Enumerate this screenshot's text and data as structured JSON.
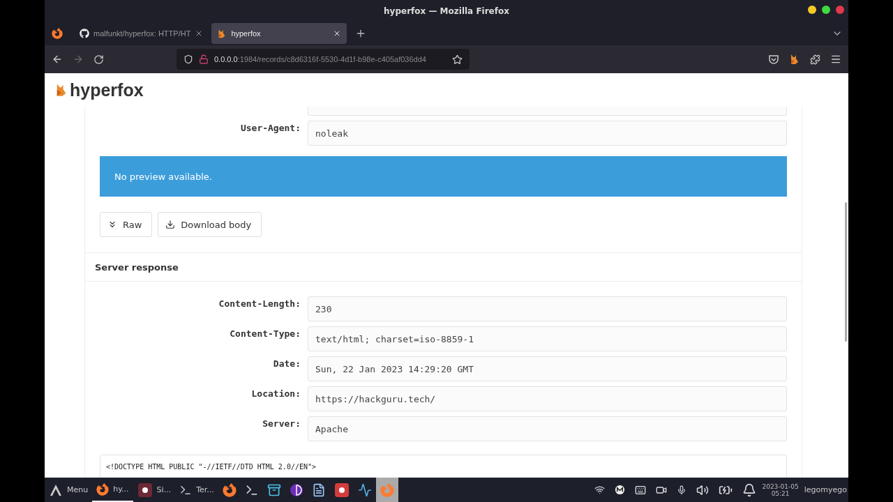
{
  "window": {
    "title": "hyperfox — Mozilla Firefox"
  },
  "tabs": [
    {
      "kind": "github",
      "label": "malfunkt/hyperfox: HTTP/HT",
      "selected": false
    },
    {
      "kind": "app",
      "label": "hyperfox",
      "selected": true
    }
  ],
  "address_bar": {
    "host": "0.0.0.0",
    "path": ":1984/records/c8d6316f-5530-4d1f-b98e-c405af036dd4"
  },
  "app": {
    "brand": "hyperfox"
  },
  "request_headers": [
    {
      "label": "User-Agent:",
      "value": "noleak"
    }
  ],
  "preview": {
    "message": "No preview available."
  },
  "actions": [
    {
      "kind": "raw",
      "label": "Raw"
    },
    {
      "kind": "download",
      "label": "Download body"
    }
  ],
  "response": {
    "title": "Server response",
    "headers": [
      {
        "label": "Content-Length:",
        "value": "230"
      },
      {
        "label": "Content-Type:",
        "value": "text/html; charset=iso-8859-1"
      },
      {
        "label": "Date:",
        "value": "Sun, 22 Jan 2023 14:29:20 GMT"
      },
      {
        "label": "Location:",
        "value": "https://hackguru.tech/"
      },
      {
        "label": "Server:",
        "value": "Apache"
      }
    ],
    "body": [
      "<!DOCTYPE HTML PUBLIC \"-//IETF//DTD HTML 2.0//EN\">"
    ]
  },
  "taskbar": {
    "menu": "Menu",
    "windows": [
      {
        "kind": "firefox",
        "label": "hy..."
      },
      {
        "kind": "record",
        "label": "Si..."
      },
      {
        "kind": "terminal",
        "label": "Ter..."
      }
    ],
    "launchers": [
      {
        "kind": "firefox",
        "selected": false
      },
      {
        "kind": "terminal",
        "selected": false
      },
      {
        "kind": "files",
        "selected": false
      },
      {
        "kind": "tor",
        "selected": false
      },
      {
        "kind": "editor",
        "selected": false
      },
      {
        "kind": "record",
        "selected": false
      },
      {
        "kind": "monitor",
        "selected": false
      },
      {
        "kind": "firefox",
        "selected": true
      }
    ],
    "date": "2023-01-05",
    "time": "05:21",
    "user": "legomyego"
  }
}
